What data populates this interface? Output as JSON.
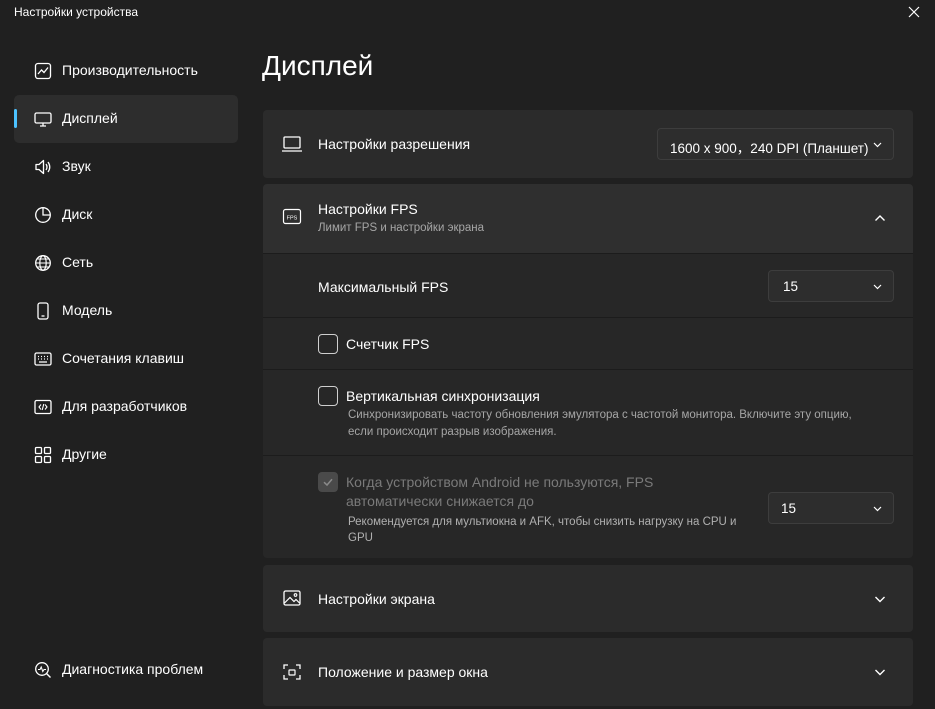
{
  "window": {
    "title": "Настройки устройства"
  },
  "sidebar": {
    "items": [
      {
        "label": "Производительность",
        "icon": "performance-chart-icon"
      },
      {
        "label": "Дисплей",
        "icon": "monitor-icon"
      },
      {
        "label": "Звук",
        "icon": "speaker-icon"
      },
      {
        "label": "Диск",
        "icon": "pie-disk-icon"
      },
      {
        "label": "Сеть",
        "icon": "globe-icon"
      },
      {
        "label": "Модель",
        "icon": "phone-icon"
      },
      {
        "label": "Сочетания клавиш",
        "icon": "keyboard-icon"
      },
      {
        "label": "Для разработчиков",
        "icon": "developer-code-icon"
      },
      {
        "label": "Другие",
        "icon": "apps-grid-icon"
      }
    ],
    "active_index": 1,
    "footer": {
      "label": "Диагностика проблем",
      "icon": "diagnostics-icon"
    }
  },
  "main": {
    "title": "Дисплей",
    "resolution": {
      "title": "Настройки разрешения",
      "value": "1600 x 900，240 DPI (Планшет)"
    },
    "fps": {
      "title": "Настройки FPS",
      "subtitle": "Лимит FPS и настройки экрана",
      "icon_text": "FPS",
      "max_fps_label": "Максимальный FPS",
      "max_fps_value": "15",
      "counter_label": "Счетчик FPS",
      "counter_checked": false,
      "vsync_label": "Вертикальная синхронизация",
      "vsync_checked": false,
      "vsync_desc_line1": "Синхронизировать частоту обновления эмулятора с частотой монитора. Включите эту опцию,",
      "vsync_desc_line2": "если происходит разрыв изображения.",
      "idle_label_line1": "Когда устройством Android не пользуются, FPS",
      "idle_label_line2": "автоматически снижается до",
      "idle_desc_line1": "Рекомендуется для мультиокна и AFK, чтобы снизить нагрузку на CPU и",
      "idle_desc_line2": "GPU",
      "idle_checked": true,
      "idle_disabled": true,
      "idle_value": "15"
    },
    "screen": {
      "title": "Настройки экрана"
    },
    "window_pos": {
      "title": "Положение и размер окна"
    }
  },
  "colors": {
    "background": "#202020",
    "card": "#2b2b2b",
    "accent": "#4cc2ff",
    "secondary_text": "#a6a6a6"
  }
}
